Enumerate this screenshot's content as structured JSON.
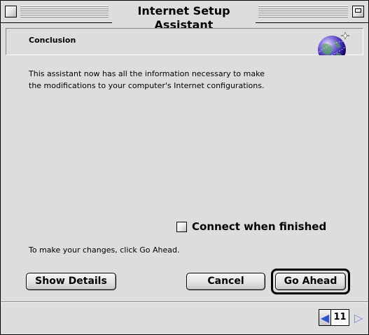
{
  "window": {
    "title": "Internet Setup Assistant"
  },
  "header": {
    "title": "Conclusion",
    "icon": "globe-icon"
  },
  "body": {
    "intro_line1": "This assistant now has all the information necessary to make",
    "intro_line2": "the modifications to your computer's Internet configurations.",
    "checkbox_label": "Connect when finished",
    "checkbox_checked": false,
    "hint": "To make your changes, click Go Ahead."
  },
  "buttons": {
    "show_details": "Show Details",
    "cancel": "Cancel",
    "go_ahead": "Go Ahead"
  },
  "nav": {
    "page_number": "11",
    "prev_icon": "triangle-left-icon",
    "next_icon": "triangle-right-icon"
  },
  "colors": {
    "window_bg": "#dddddd",
    "nav_arrow": "#3355cc"
  }
}
